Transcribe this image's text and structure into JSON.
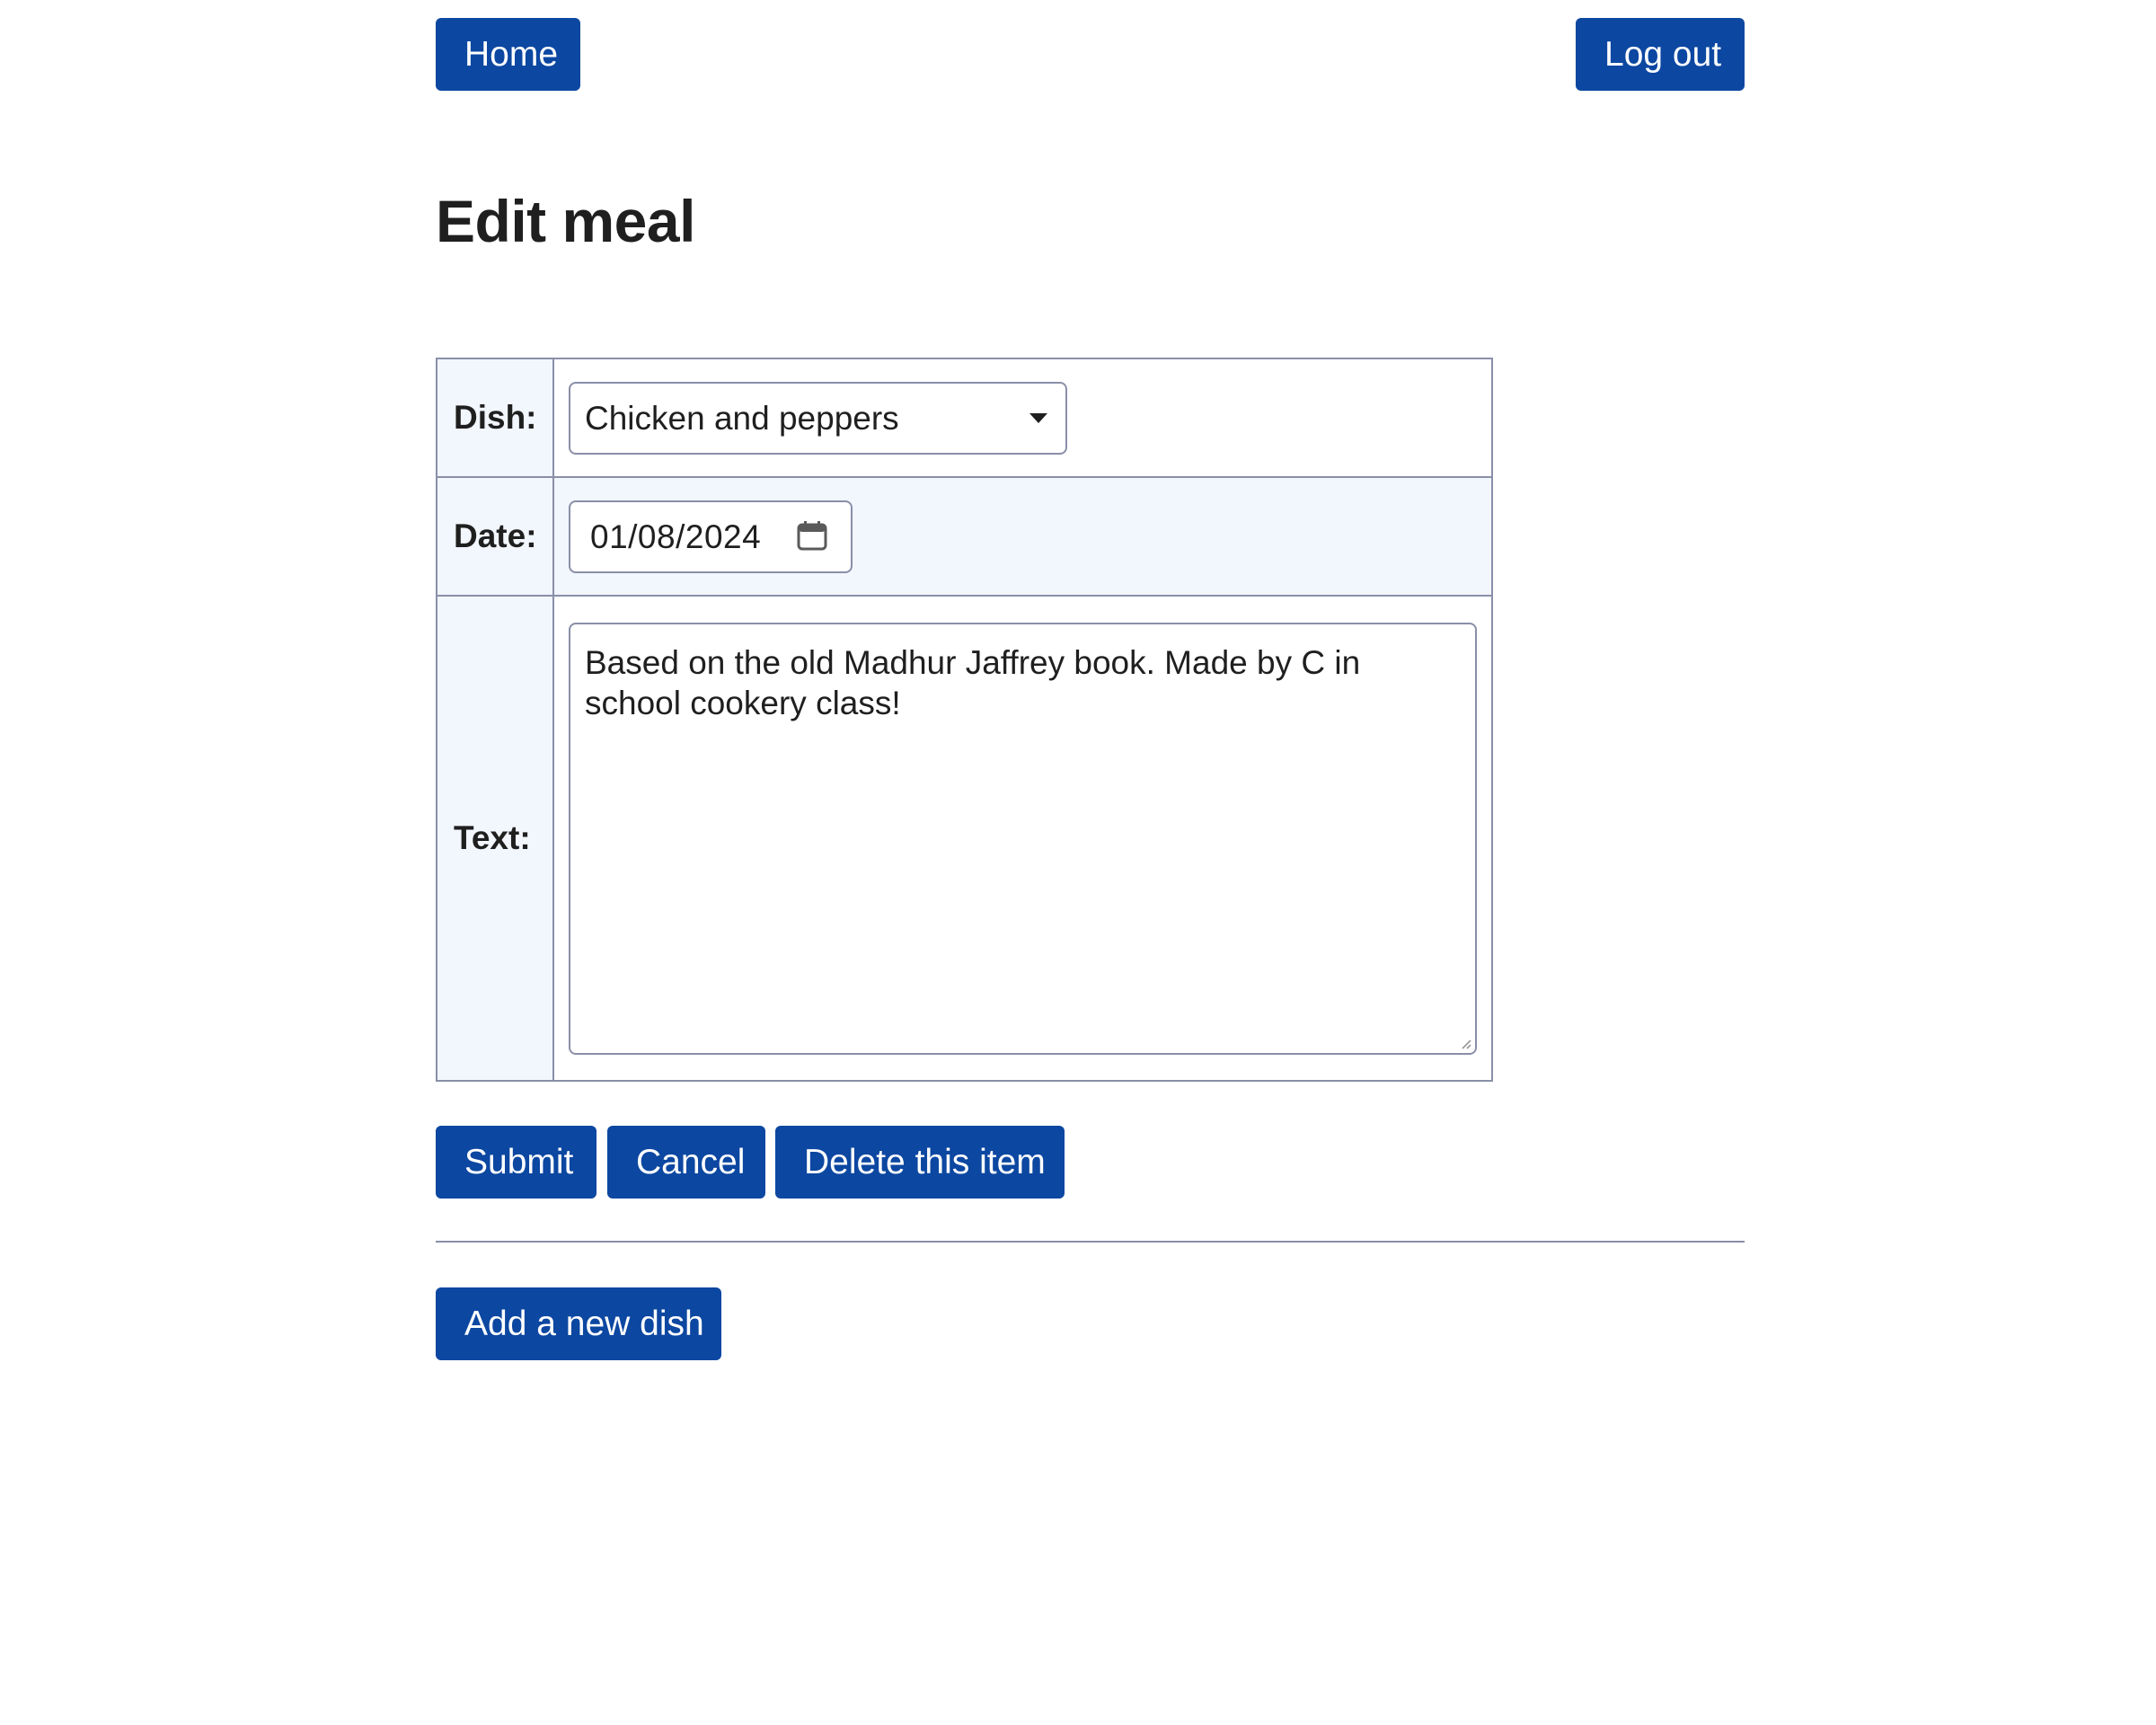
{
  "nav": {
    "home_label": "Home",
    "logout_label": "Log out"
  },
  "page": {
    "title": "Edit meal"
  },
  "form": {
    "dish": {
      "label": "Dish:",
      "selected": "Chicken and peppers"
    },
    "date": {
      "label": "Date:",
      "value": "01/08/2024"
    },
    "text": {
      "label": "Text:",
      "value": "Based on the old Madhur Jaffrey book. Made by C in school cookery class!"
    }
  },
  "actions": {
    "submit_label": "Submit",
    "cancel_label": "Cancel",
    "delete_label": "Delete this item",
    "add_dish_label": "Add a new dish"
  },
  "colors": {
    "button_bg": "#0c47a1",
    "label_cell_bg": "#f2f6fd",
    "border": "#8a8fa8"
  },
  "icons": {
    "calendar": "calendar-icon",
    "dropdown": "chevron-down-icon"
  }
}
